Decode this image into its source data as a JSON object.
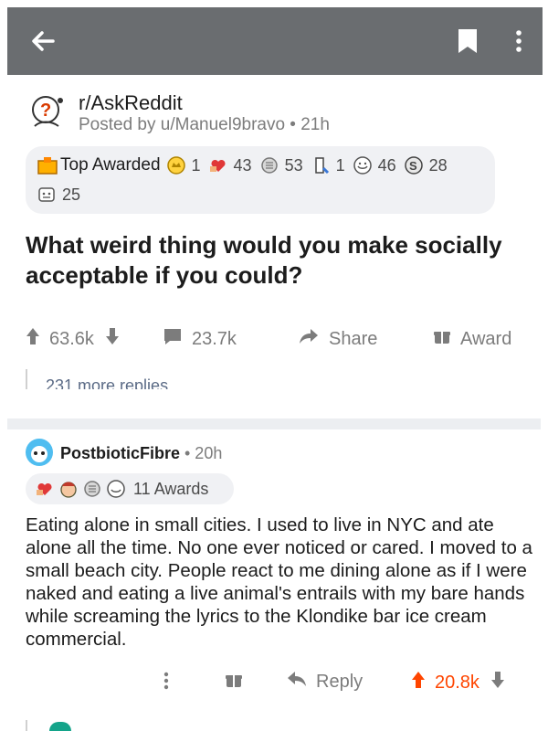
{
  "header": {
    "back_icon": "arrow-left-icon",
    "bookmark_icon": "bookmark-icon",
    "more_icon": "more-vertical-icon",
    "bg_color": "#6a6d70"
  },
  "post": {
    "subreddit": "r/AskReddit",
    "posted_by": "Posted by u/Manuel9bravo • 21h",
    "top_awarded_label": "Top Awarded",
    "awards": [
      {
        "icon": "crown-award-icon",
        "count": "1"
      },
      {
        "icon": "heart-hands-award-icon",
        "count": "43"
      },
      {
        "icon": "silver-award-icon",
        "count": "53"
      },
      {
        "icon": "rocket-award-icon",
        "count": "1"
      },
      {
        "icon": "wholesome-award-icon",
        "count": "46"
      },
      {
        "icon": "take-my-energy-award-icon",
        "count": "28"
      },
      {
        "icon": "helpful-award-icon",
        "count": "25"
      }
    ],
    "title": "What weird thing would you make socially acceptable if you could?",
    "upvotes": "63.6k",
    "comments": "23.7k",
    "share_label": "Share",
    "award_label": "Award"
  },
  "more_replies": "231 more replies",
  "comment": {
    "username": "PostbioticFibre",
    "time": "• 20h",
    "awards_count": "11 Awards",
    "body": "Eating alone in small cities. I used to live in NYC and ate alone all the time. No one ever noticed or cared. I moved to a small beach city. People react to me dining alone as if I were naked and eating a live animal's entrails with my bare hands while screaming the lyrics to the Klondike bar ice cream commercial.",
    "reply_label": "Reply",
    "score": "20.8k"
  },
  "colors": {
    "accent_orange": "#ff4500",
    "muted": "#7c7c7c",
    "award_bg": "#f0f1f4"
  }
}
